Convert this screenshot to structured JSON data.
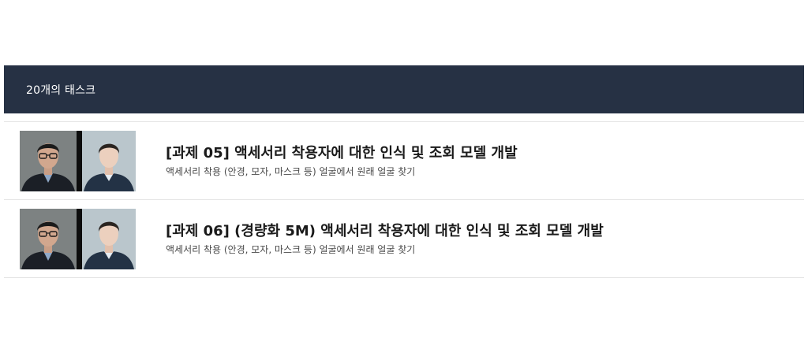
{
  "header": {
    "count_label": "20개의 태스크"
  },
  "tasks": [
    {
      "title": "[과제 05] 액세서리 착용자에 대한 인식 및 조회 모델 개발",
      "description": "액세서리 착용 (안경, 모자, 마스크 등) 얼굴에서 원래 얼굴 찾기"
    },
    {
      "title": "[과제 06] (경량화 5M) 액세서리 착용자에 대한 인식 및 조회 모델 개발",
      "description": "액세서리 착용 (안경, 모자, 마스크 등) 얼굴에서 원래 얼굴 찾기"
    }
  ],
  "colors": {
    "header_bg": "#263144",
    "header_text": "#ffffff",
    "divider": "#e4e4e4"
  }
}
